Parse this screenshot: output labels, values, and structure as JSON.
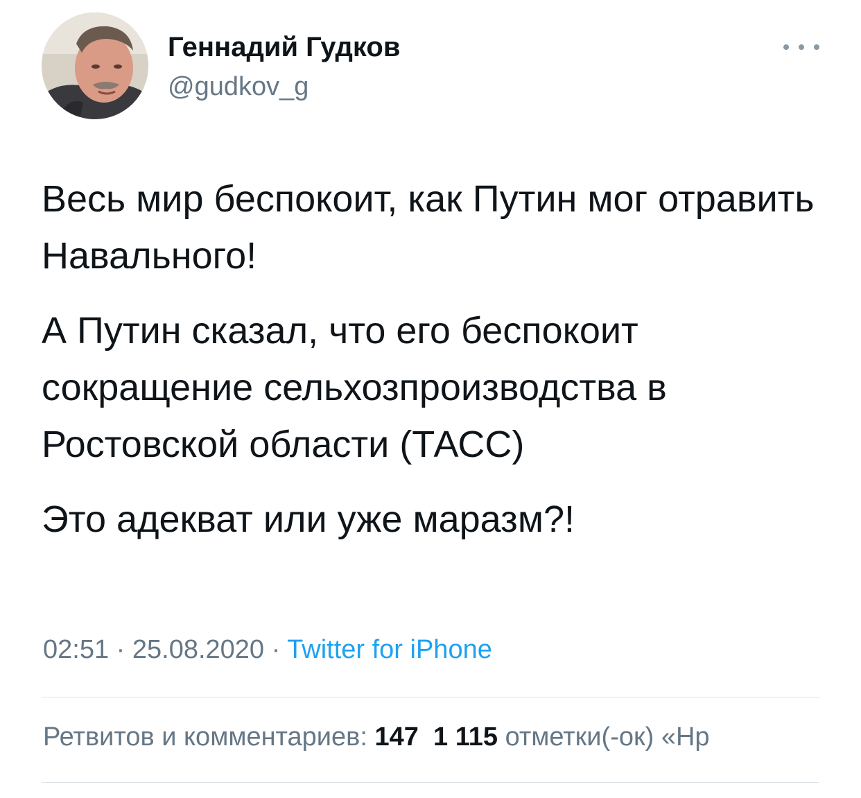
{
  "author": {
    "name": "Геннадий Гудков",
    "handle": "@gudkov_g"
  },
  "icons": {
    "avatar": "user-photo",
    "more": "more-horizontal-icon"
  },
  "tweet": {
    "paragraphs": [
      "Весь мир беспокоит, как Путин мог отравить Навального!",
      "А Путин сказал, что его беспокоит сокращение сельхозпроизводства в Ростовской области (ТАСС)",
      "Это адекват или уже маразм?!"
    ],
    "time": "02:51",
    "date": "25.08.2020",
    "separator": "·",
    "source": "Twitter for iPhone"
  },
  "stats": {
    "retweets_label": "Ретвитов и комментариев:",
    "retweets_value": "147",
    "likes_value": "1 115",
    "likes_label": "отметки(-ок) «Нр"
  },
  "colors": {
    "text": "#0f1419",
    "secondary": "#657786",
    "link": "#1da1f2",
    "divider": "#dde3e8"
  }
}
